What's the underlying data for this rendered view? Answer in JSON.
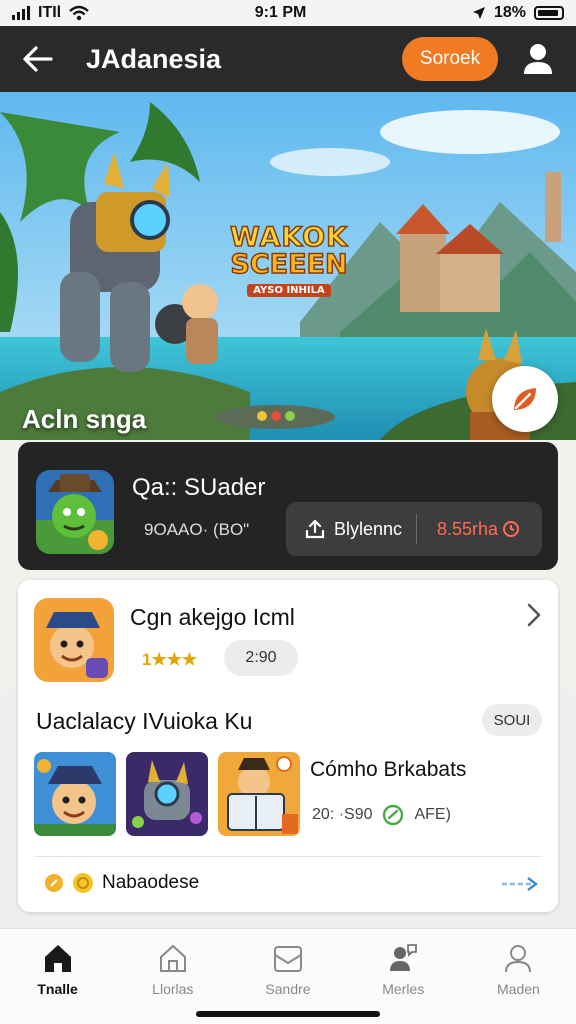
{
  "status_bar": {
    "carrier": "ITIl",
    "time": "9:1 PM",
    "battery": "18%"
  },
  "header": {
    "title": "JAdanesia",
    "search_label": "Soroek"
  },
  "hero": {
    "logo_line1": "WAKOK",
    "logo_line2": "SCEEEN",
    "logo_line3": "AYSO INHILA",
    "caption": "Acln snga"
  },
  "feature": {
    "title": "Qa:: SUader",
    "subtitle": "9OAAO· (BO\"",
    "button1_label": "Blylennc",
    "button2_label": "8.55rha"
  },
  "game1": {
    "title": "Cgn akejgo Icml",
    "rating": "1★★★",
    "badge": "2:90"
  },
  "section": {
    "title": "Uaclalacy IVuioka Ku",
    "see_all": "SOUI"
  },
  "game2": {
    "title": "Cómho Brkabats",
    "stat": "20: ·S90",
    "tag": "AFE)"
  },
  "footer": {
    "label": "Nabaodese"
  },
  "nav": {
    "items": [
      {
        "label": "Tnalle",
        "icon": "home-icon",
        "active": true
      },
      {
        "label": "Llorlas",
        "icon": "house-outline-icon",
        "active": false
      },
      {
        "label": "Sandre",
        "icon": "mail-box-icon",
        "active": false
      },
      {
        "label": "Merles",
        "icon": "chat-person-icon",
        "active": false
      },
      {
        "label": "Maden",
        "icon": "person-icon",
        "active": false
      }
    ]
  },
  "colors": {
    "accent": "#f07b23",
    "header_bg": "#2a2a2a",
    "card_dark": "#242424",
    "price_red": "#ff6b50"
  }
}
